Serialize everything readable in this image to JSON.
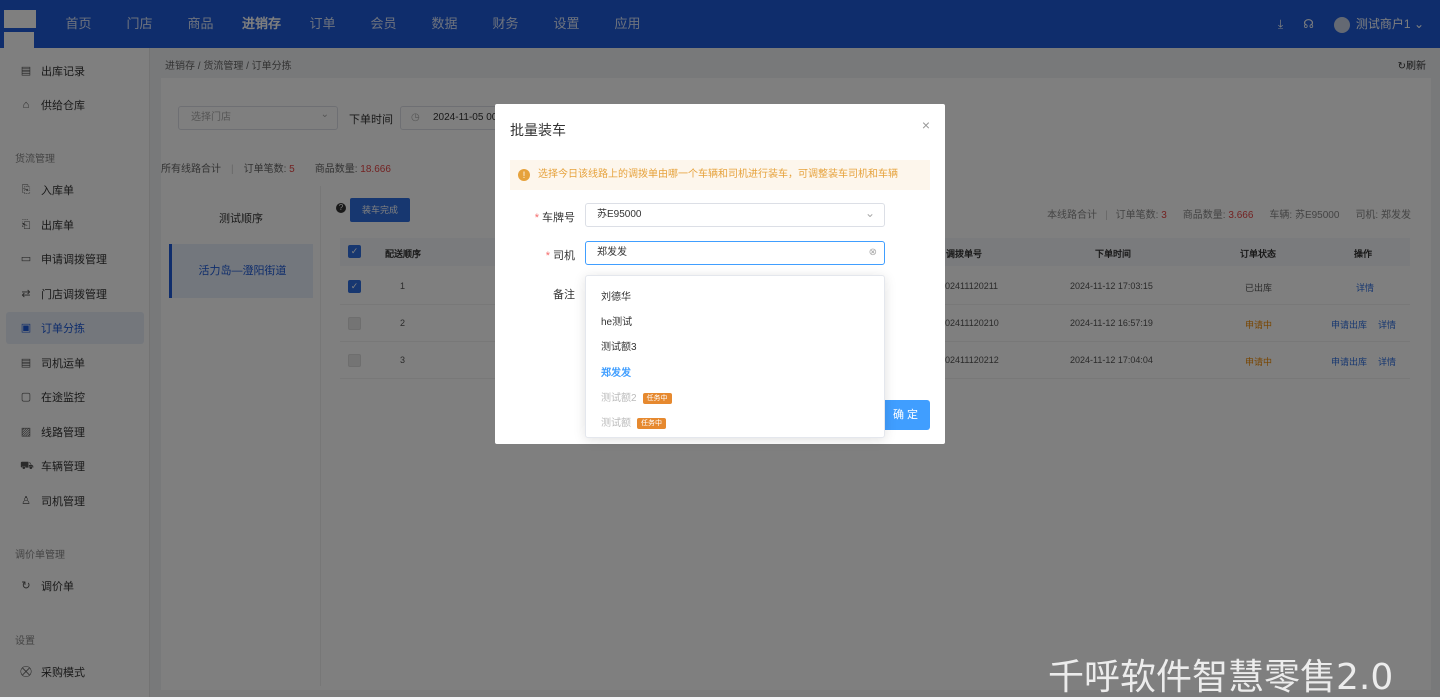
{
  "topbar": {
    "nav": [
      "首页",
      "门店",
      "商品",
      "进销存",
      "订单",
      "会员",
      "数据",
      "财务",
      "设置",
      "应用"
    ],
    "active_nav": "进销存",
    "user": "测试商户1"
  },
  "sidebar": {
    "items_top": [
      {
        "label": "出库记录",
        "icon": "list-icon"
      },
      {
        "label": "供给仓库",
        "icon": "warehouse-icon"
      }
    ],
    "group_logistics": "货流管理",
    "items_logistics": [
      {
        "label": "入库单",
        "icon": "inbound-icon"
      },
      {
        "label": "出库单",
        "icon": "outbound-icon"
      },
      {
        "label": "申请调拨管理",
        "icon": "doc-icon"
      },
      {
        "label": "门店调拨管理",
        "icon": "swap-icon"
      },
      {
        "label": "订单分拣",
        "icon": "image-icon",
        "active": true
      },
      {
        "label": "司机运单",
        "icon": "doc-icon"
      },
      {
        "label": "在途监控",
        "icon": "monitor-icon"
      },
      {
        "label": "线路管理",
        "icon": "route-icon"
      },
      {
        "label": "车辆管理",
        "icon": "truck-icon"
      },
      {
        "label": "司机管理",
        "icon": "user-icon"
      }
    ],
    "group_price": "调价单管理",
    "items_price": [
      {
        "label": "调价单",
        "icon": "refresh-icon"
      }
    ],
    "group_settings": "设置",
    "items_settings": [
      {
        "label": "采购模式",
        "icon": "cart-icon"
      }
    ]
  },
  "main": {
    "breadcrumb": "进销存 / 货流管理 / 订单分拣",
    "refresh": "刷新",
    "store_placeholder": "选择门店",
    "date_label": "下单时间",
    "date_value": "2024-11-05 00:00:00",
    "summary": {
      "all_routes": "所有线路合计",
      "orders_label": "订单笔数:",
      "orders": "5",
      "qty_label": "商品数量:",
      "qty": "18.666"
    },
    "route_head": "测试顺序",
    "route_item": "活力岛—澄阳街道",
    "load_button": "装车完成",
    "route_summary": {
      "label": "本线路合计",
      "orders_label": "订单笔数:",
      "orders": "3",
      "qty_label": "商品数量:",
      "qty": "3.666",
      "vehicle_label": "车辆:",
      "vehicle": "苏E95000",
      "driver_label": "司机:",
      "driver": "郑发发"
    },
    "columns": {
      "seq": "配送顺序",
      "no": "调拨单号",
      "time": "下单时间",
      "status": "订单状态",
      "ops": "操作"
    },
    "rows": [
      {
        "seq": "1",
        "no": "202411120211",
        "time": "2024-11-12 17:03:15",
        "status": "已出库",
        "op1": "详情",
        "op2": "",
        "checked": true
      },
      {
        "seq": "2",
        "no": "202411120210",
        "time": "2024-11-12 16:57:19",
        "status": "申请中",
        "op1": "申请出库",
        "op2": "详情",
        "checked": false
      },
      {
        "seq": "3",
        "no": "202411120212",
        "time": "2024-11-12 17:04:04",
        "status": "申请中",
        "op1": "申请出库",
        "op2": "详情",
        "checked": false
      }
    ]
  },
  "dialog": {
    "title": "批量装车",
    "alert": "选择今日该线路上的调拨单由哪一个车辆和司机进行装车，可调整装车司机和车辆",
    "plate_label": "车牌号",
    "plate_value": "苏E95000",
    "driver_label": "司机",
    "driver_value": "郑发发",
    "remark_label": "备注",
    "confirm": "确 定",
    "options": [
      {
        "label": "刘德华",
        "state": "normal",
        "tag": ""
      },
      {
        "label": "he测试",
        "state": "normal",
        "tag": ""
      },
      {
        "label": "测试额3",
        "state": "normal",
        "tag": ""
      },
      {
        "label": "郑发发",
        "state": "selected",
        "tag": ""
      },
      {
        "label": "测试额2",
        "state": "disabled",
        "tag": "任务中"
      },
      {
        "label": "测试额",
        "state": "disabled",
        "tag": "任务中"
      }
    ]
  },
  "watermark": "千呼软件智慧零售2.0"
}
